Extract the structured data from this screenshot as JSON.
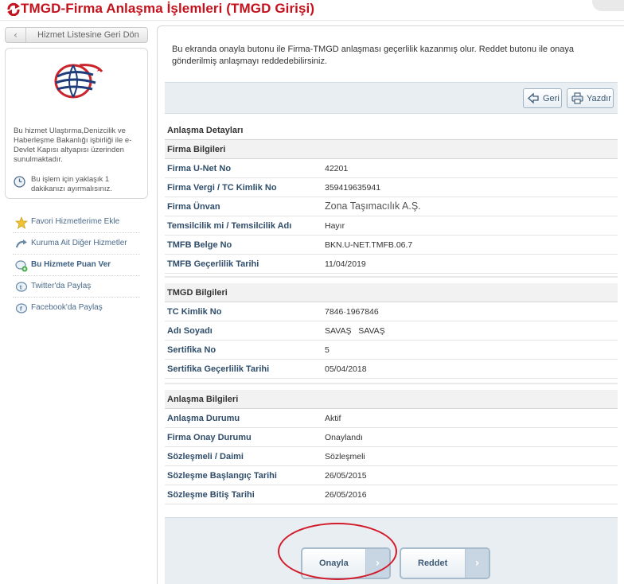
{
  "header": {
    "title": "TMGD-Firma Anlaşma İşlemleri (TMGD Girişi)"
  },
  "sidebar": {
    "back_label": "Hizmet Listesine Geri Dön",
    "description": "Bu hizmet Ulaştırma,Denizcilik ve Haberleşme Bakanlığı işbirliği ile e-Devlet Kapısı altyapısı üzerinden sunulmaktadır.",
    "time_note": "Bu işlem için yaklaşık 1 dakikanızı ayırmalısınız.",
    "links": [
      {
        "label": "Favori Hizmetlerime Ekle",
        "icon": "star-icon"
      },
      {
        "label": "Kuruma Ait Diğer Hizmetler",
        "icon": "arrow-icon"
      },
      {
        "label": "Bu Hizmete Puan Ver",
        "icon": "rate-icon"
      },
      {
        "label": "Twitter'da Paylaş",
        "icon": "twitter-icon"
      },
      {
        "label": "Facebook'da Paylaş",
        "icon": "facebook-icon"
      }
    ]
  },
  "main": {
    "intro": "Bu ekranda onayla butonu ile Firma-TMGD anlaşması geçerlilik kazanmış olur. Reddet butonu ile onaya gönderilmiş anlaşmayı reddedebilirsiniz.",
    "toolbar": {
      "back_label": "Geri",
      "print_label": "Yazdır"
    },
    "details_title": "Anlaşma Detayları",
    "firma": {
      "title": "Firma Bilgileri",
      "rows": [
        {
          "label": "Firma U-Net No",
          "value": "42201"
        },
        {
          "label": "Firma Vergi / TC Kimlik No",
          "value": "359419635941"
        },
        {
          "label": "Firma Ünvan",
          "value": "Zona Taşımacılık A.Ş."
        },
        {
          "label": "Temsilcilik mi / Temsilcilik Adı",
          "value": "Hayır"
        },
        {
          "label": "TMFB Belge No",
          "value": "BKN.U-NET.TMFB.06.7"
        },
        {
          "label": "TMFB Geçerlilik Tarihi",
          "value": "11/04/2019"
        }
      ]
    },
    "tmgd": {
      "title": "TMGD Bilgileri",
      "rows": [
        {
          "label": "TC Kimlik No",
          "value": "7846·1967846"
        },
        {
          "label": "Adı Soyadı",
          "value": "SAVAŞ   SAVAŞ"
        },
        {
          "label": "Sertifika No",
          "value": "5"
        },
        {
          "label": "Sertifika Geçerlilik Tarihi",
          "value": "05/04/2018"
        }
      ]
    },
    "anlasma": {
      "title": "Anlaşma Bilgileri",
      "rows": [
        {
          "label": "Anlaşma Durumu",
          "value": "Aktif"
        },
        {
          "label": "Firma Onay Durumu",
          "value": "Onaylandı"
        },
        {
          "label": "Sözleşmeli / Daimi",
          "value": "Sözleşmeli"
        },
        {
          "label": "Sözleşme Başlangıç Tarihi",
          "value": "26/05/2015"
        },
        {
          "label": "Sözleşme Bitiş Tarihi",
          "value": "26/05/2016"
        }
      ]
    },
    "actions": {
      "approve_label": "Onayla",
      "reject_label": "Reddet"
    }
  },
  "colors": {
    "title_red": "#c4121c",
    "label_blue": "#2f4d6a",
    "panel_bg": "#e9eef2",
    "annotation_red": "#d21a2a"
  }
}
